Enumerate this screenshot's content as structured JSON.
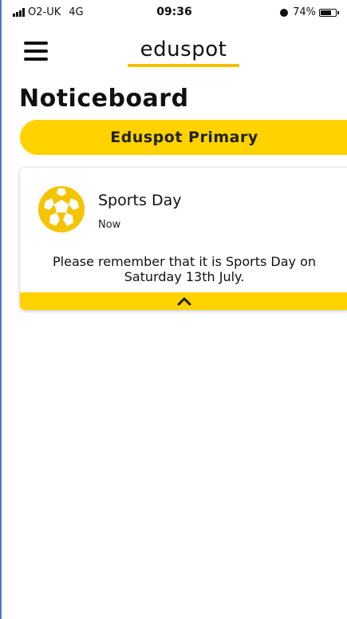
{
  "status_bar": {
    "carrier": "O2-UK",
    "network": "4G",
    "time": "09:36",
    "battery_percent": "74%",
    "battery_level": 0.74
  },
  "header": {
    "logo_text": "eduspot",
    "menu_icon": "hamburger-menu-icon"
  },
  "page": {
    "title": "Noticeboard"
  },
  "school_selector": {
    "label": "Eduspot Primary"
  },
  "notices": [
    {
      "icon": "football-icon",
      "title": "Sports Day",
      "time": "Now",
      "body": "Please remember that it is Sports Day on Saturday 13th July.",
      "collapse_icon": "chevron-up-icon"
    }
  ],
  "colors": {
    "accent": "#ffd200",
    "logo_underline": "#f2c300",
    "icon_yellow": "#f5c400"
  }
}
